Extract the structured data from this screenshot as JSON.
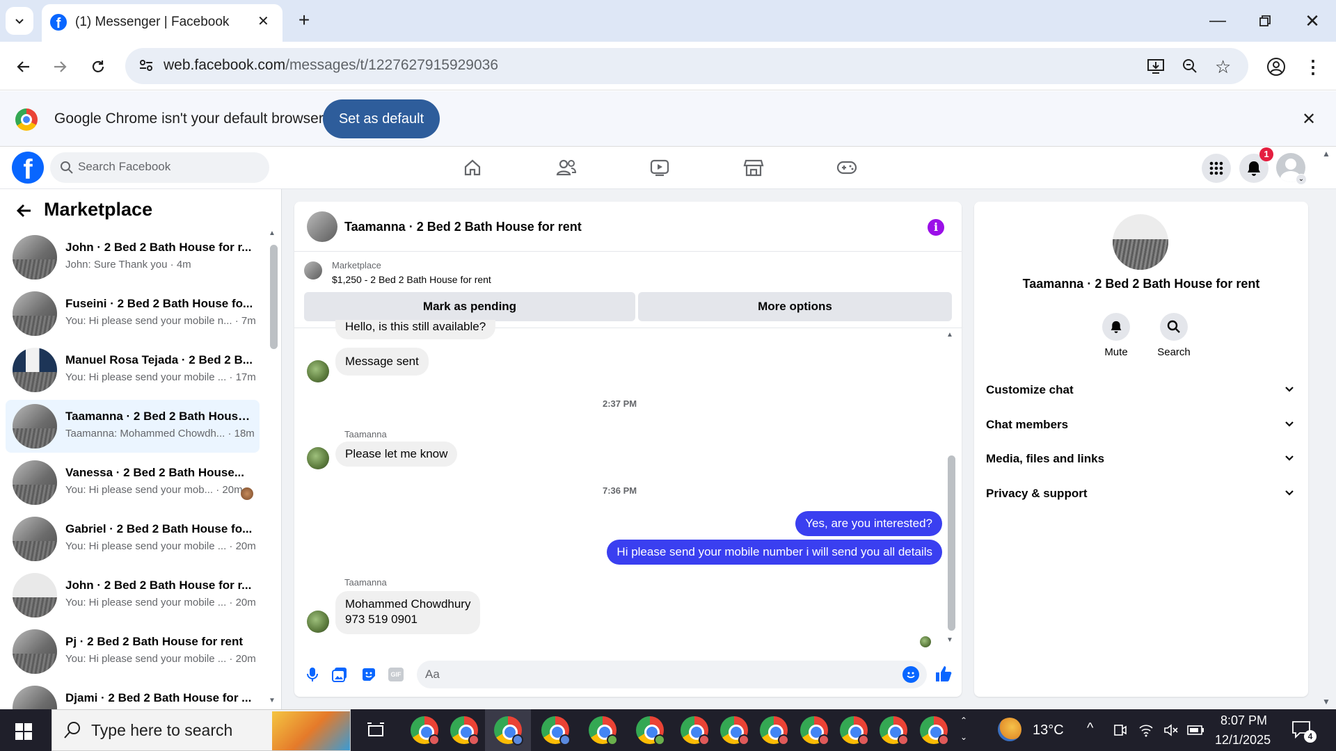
{
  "browser": {
    "tab_title": "(1) Messenger | Facebook",
    "url_domain": "web.facebook.com",
    "url_path": "/messages/t/1227627915929036",
    "infobar_text": "Google Chrome isn't your default browser",
    "infobar_button": "Set as default"
  },
  "facebook": {
    "search_placeholder": "Search Facebook",
    "notification_count": "1",
    "nav_icons": [
      "home-icon",
      "friends-icon",
      "video-icon",
      "marketplace-icon",
      "gaming-icon"
    ]
  },
  "sidebar": {
    "title": "Marketplace",
    "conversations": [
      {
        "name": "John · 2 Bed 2 Bath House for r...",
        "snippet": "John: Sure Thank you · 4m"
      },
      {
        "name": "Fuseini · 2 Bed 2 Bath House fo...",
        "snippet": "You: Hi please send your mobile n... · 7m"
      },
      {
        "name": "Manuel Rosa Tejada · 2 Bed 2 B...",
        "snippet": "You: Hi please send your mobile ... · 17m"
      },
      {
        "name": "Taamanna · 2 Bed 2 Bath House...",
        "snippet": "Taamanna: Mohammed Chowdh... · 18m"
      },
      {
        "name": "Vanessa · 2 Bed 2 Bath House...",
        "snippet": "You: Hi please send your mob... · 20m"
      },
      {
        "name": "Gabriel · 2 Bed 2 Bath House fo...",
        "snippet": "You: Hi please send your mobile ... · 20m"
      },
      {
        "name": "John · 2 Bed 2 Bath House for r...",
        "snippet": "You: Hi please send your mobile ... · 20m"
      },
      {
        "name": "Pj · 2 Bed 2 Bath House for rent",
        "snippet": "You: Hi please send your mobile ... · 20m"
      },
      {
        "name": "Djami · 2 Bed 2 Bath House for ...",
        "snippet": ""
      }
    ]
  },
  "chat": {
    "title": "Taamanna · 2 Bed 2 Bath House for rent",
    "listing_label": "Marketplace",
    "listing_text": "$1,250 - 2 Bed 2 Bath House for rent",
    "btn_pending": "Mark as pending",
    "btn_more": "More options",
    "msg_1": "Hello, is this still available?",
    "msg_2": "Message sent",
    "time_1": "2:37 PM",
    "sender_1": "Taamanna",
    "msg_3": "Please let me know",
    "time_2": "7:36 PM",
    "out_1": "Yes, are you interested?",
    "out_2": "Hi please send your mobile number i will send you all details",
    "sender_2": "Taamanna",
    "msg_4_line1": "Mohammed Chowdhury",
    "msg_4_line2": "973 519 0901",
    "composer_placeholder": "Aa"
  },
  "details": {
    "title": "Taamanna · 2 Bed 2 Bath House for rent",
    "mute_label": "Mute",
    "search_label": "Search",
    "sections": [
      "Customize chat",
      "Chat members",
      "Media, files and links",
      "Privacy & support"
    ]
  },
  "taskbar": {
    "search_placeholder": "Type here to search",
    "weather": "13°C",
    "time": "8:07 PM",
    "date": "12/1/2025",
    "notif_count": "4"
  },
  "colors": {
    "fb_blue": "#0866ff",
    "outgoing_bubble": "#3a3ff0",
    "info_purple": "#9b0fe8"
  }
}
